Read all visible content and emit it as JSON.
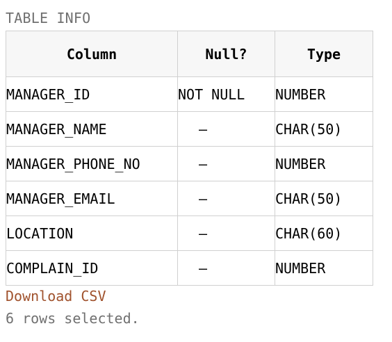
{
  "section_title": "TABLE INFO",
  "table": {
    "headers": [
      "Column",
      "Null?",
      "Type"
    ],
    "rows": [
      {
        "column": "MANAGER_ID",
        "null": "NOT NULL",
        "type": "NUMBER"
      },
      {
        "column": "MANAGER_NAME",
        "null": "–",
        "type": "CHAR(50)"
      },
      {
        "column": "MANAGER_PHONE_NO",
        "null": "–",
        "type": "NUMBER"
      },
      {
        "column": "MANAGER_EMAIL",
        "null": "–",
        "type": "CHAR(50)"
      },
      {
        "column": "LOCATION",
        "null": "–",
        "type": "CHAR(60)"
      },
      {
        "column": "COMPLAIN_ID",
        "null": "–",
        "type": "NUMBER"
      }
    ]
  },
  "download_label": "Download CSV",
  "status": "6 rows selected.",
  "colors": {
    "link": "#a0522d",
    "muted_text": "#707070",
    "header_bg": "#f7f7f7",
    "border": "#d0d0d0"
  }
}
